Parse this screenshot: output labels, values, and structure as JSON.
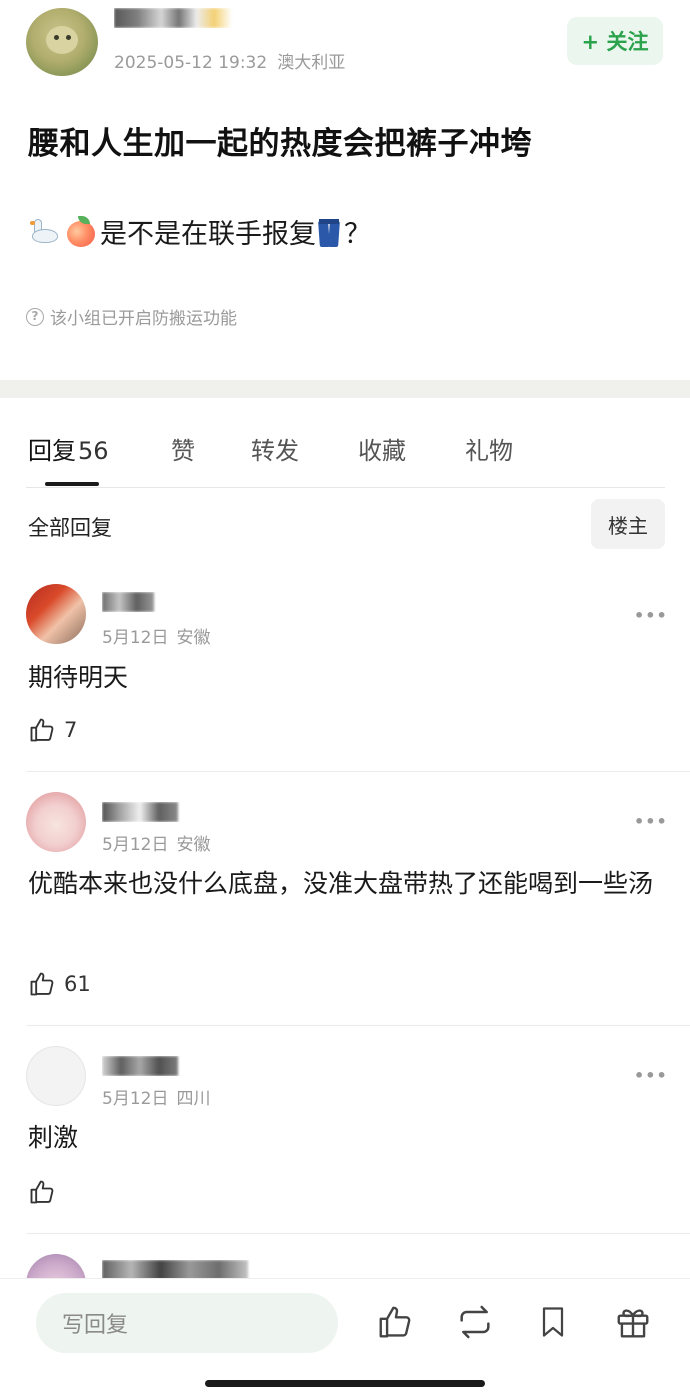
{
  "post": {
    "author_name": "",
    "timestamp": "2025-05-12 19:32",
    "location": "澳大利亚",
    "follow_label": "+ 关注",
    "title": "腰和人生加一起的热度会把裤子冲垮",
    "body_text": "是不是在联手报复",
    "body_emojis": [
      "swan",
      "peach",
      "jeans"
    ],
    "body_suffix": "？",
    "anti_copy_notice": "该小组已开启防搬运功能"
  },
  "tabs": [
    {
      "label": "回复",
      "count": "56",
      "active": true
    },
    {
      "label": "赞"
    },
    {
      "label": "转发"
    },
    {
      "label": "收藏"
    },
    {
      "label": "礼物"
    }
  ],
  "filter": {
    "all_label": "全部回复",
    "op_label": "楼主"
  },
  "comments": [
    {
      "date": "5月12日",
      "location": "安徽",
      "text": "期待明天",
      "likes": "7"
    },
    {
      "date": "5月12日",
      "location": "安徽",
      "text": "优酷本来也没什么底盘，没准大盘带热了还能喝到一些汤",
      "likes": "61"
    },
    {
      "date": "5月12日",
      "location": "四川",
      "text": "刺激",
      "likes": ""
    }
  ],
  "bottom": {
    "reply_placeholder": "写回复",
    "icons": [
      "thumbs-up-icon",
      "repost-icon",
      "bookmark-icon",
      "gift-icon"
    ]
  },
  "colors": {
    "accent_green": "#2ba24c",
    "follow_bg": "#eaf6ee",
    "separator": "#f0f0ec",
    "meta_gray": "#9a9a9a"
  }
}
